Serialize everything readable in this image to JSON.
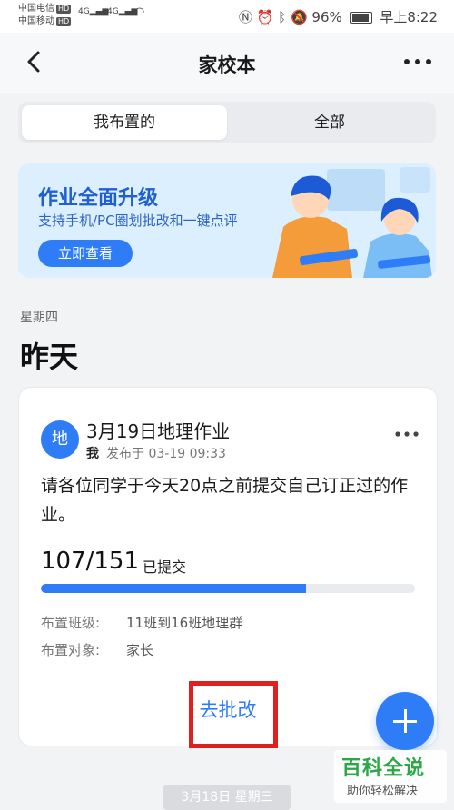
{
  "status_bar": {
    "carrier_1": "中国电信",
    "carrier_2": "中国移动",
    "hd": "HD",
    "net": "4G",
    "battery": "96%",
    "time": "早上8:22"
  },
  "nav": {
    "title": "家校本"
  },
  "segments": {
    "mine": "我布置的",
    "all": "全部"
  },
  "banner": {
    "title": "作业全面升级",
    "subtitle": "支持手机/PC圈划批改和一键点评",
    "button": "立即查看"
  },
  "day": {
    "weekday": "星期四",
    "label": "昨天"
  },
  "card": {
    "avatar_text": "地",
    "title": "3月19日地理作业",
    "author": "我",
    "published": "发布于 03-19 09:33",
    "body": "请各位同学于今天20点之前提交自己订正过的作业。",
    "submitted_count": "107/151",
    "submitted_label": "已提交",
    "progress_fraction": 0.709,
    "class_label": "布置班级:",
    "class_value": "11班到16班地理群",
    "target_label": "布置对象:",
    "target_value": "家长",
    "action": "去批改"
  },
  "next_date": "3月18日 星期三",
  "watermark": {
    "main": "百科全说",
    "sub": "助你轻松解决"
  },
  "colors": {
    "accent": "#2f7df6",
    "highlight": "#e0201c",
    "watermark_green": "#2aa845"
  }
}
